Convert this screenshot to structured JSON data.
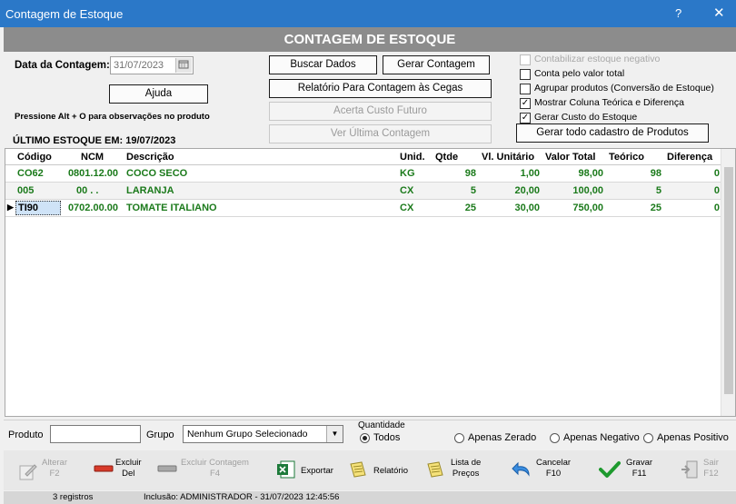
{
  "window": {
    "title": "Contagem de Estoque",
    "help": "?",
    "close": "✕"
  },
  "banner": "CONTAGEM DE ESTOQUE",
  "date": {
    "label": "Data da Contagem:",
    "value": "31/07/2023"
  },
  "buttons": {
    "ajuda": "Ajuda",
    "buscar": "Buscar Dados",
    "gerar_contagem": "Gerar Contagem",
    "relatorio_cegas": "Relatório Para Contagem às Cegas",
    "acerta_custo": "Acerta Custo Futuro",
    "ver_ultima": "Ver Última Contagem",
    "gerar_todo": "Gerar todo cadastro de Produtos"
  },
  "hint": "Pressione Alt + O para observações no produto",
  "last_stock": "ÚLTIMO ESTOQUE EM: 19/07/2023",
  "checks": [
    {
      "label": "Contabilizar estoque negativo",
      "checked": false,
      "disabled": true
    },
    {
      "label": "Conta pelo valor total",
      "checked": false,
      "disabled": false
    },
    {
      "label": "Agrupar produtos (Conversão de Estoque)",
      "checked": false,
      "disabled": false
    },
    {
      "label": "Mostrar Coluna Teórica e Diferença",
      "checked": true,
      "disabled": false
    },
    {
      "label": "Gerar Custo do Estoque",
      "checked": true,
      "disabled": false
    }
  ],
  "table": {
    "headers": {
      "codigo": "Código",
      "ncm": "NCM",
      "descricao": "Descrição",
      "unid": "Unid.",
      "qtde": "Qtde",
      "vl_unit": "Vl. Unitário",
      "valor_total": "Valor Total",
      "teorico": "Teórico",
      "diferenca": "Diferença"
    },
    "rows": [
      {
        "codigo": "CO62",
        "ncm": "0801.12.00",
        "descricao": "COCO SECO",
        "unid": "KG",
        "qtde": "98",
        "vl_unit": "1,00",
        "valor_total": "98,00",
        "teorico": "98",
        "diferenca": "0"
      },
      {
        "codigo": "005",
        "ncm": "00 . .",
        "descricao": "LARANJA",
        "unid": "CX",
        "qtde": "5",
        "vl_unit": "20,00",
        "valor_total": "100,00",
        "teorico": "5",
        "diferenca": "0"
      },
      {
        "codigo": "TI90",
        "ncm": "0702.00.00",
        "descricao": "TOMATE ITALIANO",
        "unid": "CX",
        "qtde": "25",
        "vl_unit": "30,00",
        "valor_total": "750,00",
        "teorico": "25",
        "diferenca": "0"
      }
    ]
  },
  "filter": {
    "produto_label": "Produto",
    "grupo_label": "Grupo",
    "grupo_value": "Nenhum Grupo Selecionado",
    "quantidade_label": "Quantidade",
    "radios": [
      "Todos",
      "Apenas Zerado",
      "Apenas Negativo",
      "Apenas Positivo"
    ],
    "selected": "Todos"
  },
  "toolbar": {
    "alterar": "Alterar\nF2",
    "excluir": "Excluir\nDel",
    "excluir_contagem": "Excluir Contagem\nF4",
    "exportar": "Exportar",
    "relatorio": "Relatório",
    "lista_precos": "Lista de\nPreços",
    "cancelar": "Cancelar\nF10",
    "gravar": "Gravar\nF11",
    "sair": "Sair\nF12"
  },
  "status": {
    "registros": "3 registros",
    "inclusao": "Inclusão: ADMINISTRADOR - 31/07/2023 12:45:56"
  },
  "colors": {
    "titlebar": "#2b78c8",
    "banner": "#8c8c8c",
    "row_text": "#1b7a1b"
  }
}
